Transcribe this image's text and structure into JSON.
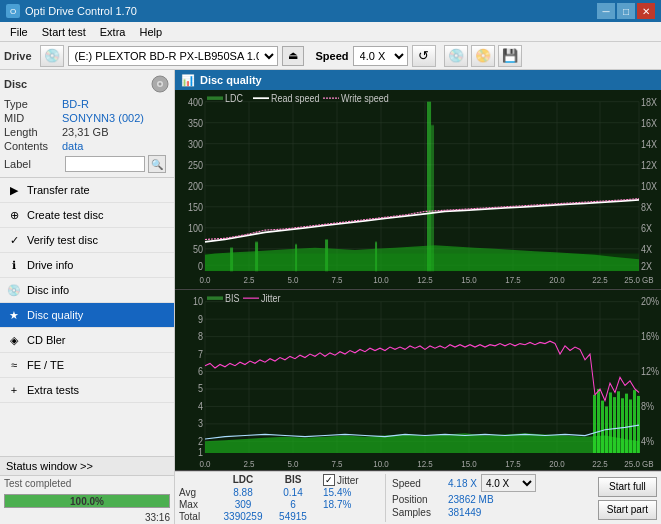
{
  "titleBar": {
    "title": "Opti Drive Control 1.70",
    "minBtn": "─",
    "maxBtn": "□",
    "closeBtn": "✕"
  },
  "menuBar": {
    "items": [
      "File",
      "Start test",
      "Extra",
      "Help"
    ]
  },
  "driveBar": {
    "label": "Drive",
    "driveValue": "(E:)  PLEXTOR BD-R  PX-LB950SA 1.06",
    "speedLabel": "Speed",
    "speedValue": "4.0 X"
  },
  "disc": {
    "title": "Disc",
    "typeLabel": "Type",
    "typeValue": "BD-R",
    "midLabel": "MID",
    "midValue": "SONYNN3 (002)",
    "lengthLabel": "Length",
    "lengthValue": "23,31 GB",
    "contentsLabel": "Contents",
    "contentsValue": "data",
    "labelLabel": "Label",
    "labelValue": ""
  },
  "nav": {
    "items": [
      {
        "id": "transfer-rate",
        "label": "Transfer rate",
        "icon": "▶"
      },
      {
        "id": "create-test-disc",
        "label": "Create test disc",
        "icon": "⊕"
      },
      {
        "id": "verify-test-disc",
        "label": "Verify test disc",
        "icon": "✓"
      },
      {
        "id": "drive-info",
        "label": "Drive info",
        "icon": "ℹ"
      },
      {
        "id": "disc-info",
        "label": "Disc info",
        "icon": "💿"
      },
      {
        "id": "disc-quality",
        "label": "Disc quality",
        "icon": "★",
        "active": true
      },
      {
        "id": "cd-bler",
        "label": "CD Bler",
        "icon": "◈"
      },
      {
        "id": "fe-te",
        "label": "FE / TE",
        "icon": "≈"
      },
      {
        "id": "extra-tests",
        "label": "Extra tests",
        "icon": "+"
      }
    ]
  },
  "statusSection": {
    "statusWindowLabel": "Status window >>",
    "statusText": "Test completed",
    "progressValue": "100.0%",
    "timeValue": "33:16"
  },
  "discQuality": {
    "title": "Disc quality",
    "legend": {
      "ldc": "LDC",
      "readSpeed": "Read speed",
      "writeSpeed": "Write speed",
      "bis": "BIS",
      "jitter": "Jitter"
    }
  },
  "statsTable": {
    "headers": [
      "LDC",
      "BIS",
      "",
      "Jitter",
      "Speed",
      ""
    ],
    "avgLabel": "Avg",
    "maxLabel": "Max",
    "totalLabel": "Total",
    "avgLDC": "8.88",
    "avgBIS": "0.14",
    "avgJitter": "15.4%",
    "maxLDC": "309",
    "maxBIS": "6",
    "maxJitter": "18.7%",
    "totalLDC": "3390259",
    "totalBIS": "54915",
    "speedLabel": "Speed",
    "speedValue": "4.18 X",
    "speedSelect": "4.0 X",
    "positionLabel": "Position",
    "positionValue": "23862 MB",
    "samplesLabel": "Samples",
    "samplesValue": "381449",
    "startFullLabel": "Start full",
    "startPartLabel": "Start part"
  },
  "chart1": {
    "yAxisLeft": [
      "400",
      "350",
      "300",
      "250",
      "200",
      "150",
      "100",
      "50",
      "0"
    ],
    "yAxisRight": [
      "18X",
      "16X",
      "14X",
      "12X",
      "10X",
      "8X",
      "6X",
      "4X",
      "2X"
    ],
    "xAxis": [
      "0.0",
      "2.5",
      "5.0",
      "7.5",
      "10.0",
      "12.5",
      "15.0",
      "17.5",
      "20.0",
      "22.5",
      "25.0 GB"
    ]
  },
  "chart2": {
    "yAxisLeft": [
      "10",
      "9",
      "8",
      "7",
      "6",
      "5",
      "4",
      "3",
      "2",
      "1"
    ],
    "yAxisRight": [
      "20%",
      "16%",
      "12%",
      "8%",
      "4%"
    ],
    "xAxis": [
      "0.0",
      "2.5",
      "5.0",
      "7.5",
      "10.0",
      "12.5",
      "15.0",
      "17.5",
      "20.0",
      "22.5",
      "25.0 GB"
    ]
  }
}
